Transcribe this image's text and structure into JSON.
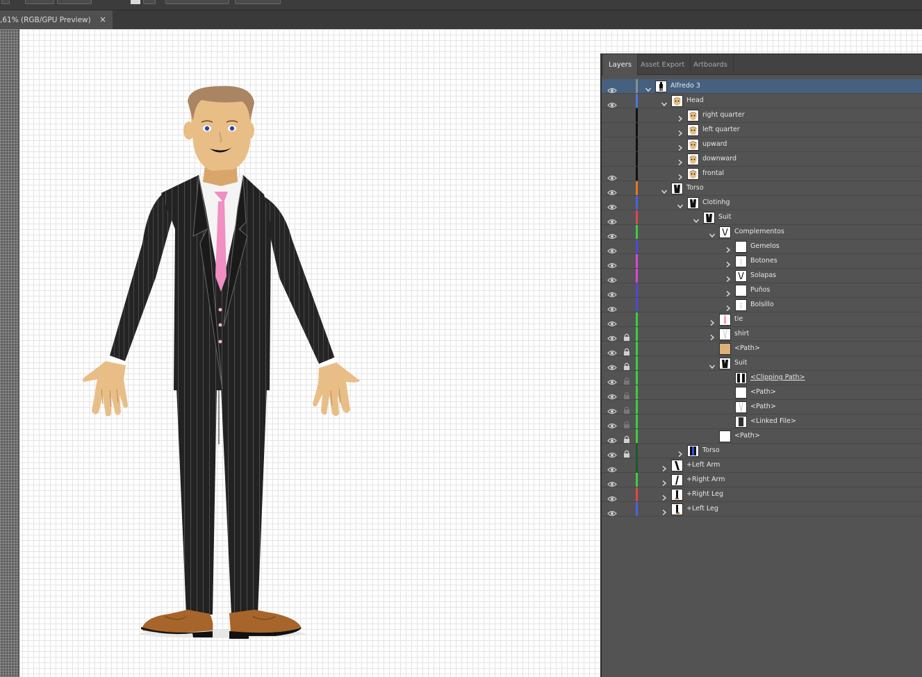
{
  "document_tab": {
    "title": ",61% (RGB/GPU Preview)",
    "close_glyph": "×"
  },
  "colors": {
    "canvas_background": "#ffffff",
    "grid_line": "#e4e4e4",
    "panel_background": "#535353",
    "selected_row": "#46607f"
  },
  "layers_panel": {
    "tabs": [
      {
        "label": "Layers",
        "active": true
      },
      {
        "label": "Asset Export",
        "active": false
      },
      {
        "label": "Artboards",
        "active": false
      }
    ],
    "layers": [
      {
        "name": "Alfredo 3",
        "depth": 0,
        "expanded": true,
        "visible": true,
        "locked": false,
        "color": "#8d8d8d",
        "selected": true,
        "thumb": "figure"
      },
      {
        "name": "Head",
        "depth": 1,
        "expanded": true,
        "visible": true,
        "locked": false,
        "color": "#4a78e0",
        "thumb": "face"
      },
      {
        "name": "right quarter",
        "depth": 2,
        "expanded": false,
        "visible": false,
        "locked": false,
        "color": "#111111",
        "thumb": "face"
      },
      {
        "name": "left quarter",
        "depth": 2,
        "expanded": false,
        "visible": false,
        "locked": false,
        "color": "#111111",
        "thumb": "face"
      },
      {
        "name": "upward",
        "depth": 2,
        "expanded": false,
        "visible": false,
        "locked": false,
        "color": "#111111",
        "thumb": "face"
      },
      {
        "name": "downward",
        "depth": 2,
        "expanded": false,
        "visible": false,
        "locked": false,
        "color": "#111111",
        "thumb": "face"
      },
      {
        "name": "frontal",
        "depth": 2,
        "expanded": false,
        "visible": true,
        "locked": false,
        "color": "#111111",
        "thumb": "face"
      },
      {
        "name": "Torso",
        "depth": 1,
        "expanded": true,
        "visible": true,
        "locked": false,
        "color": "#e07a28",
        "thumb": "torso"
      },
      {
        "name": "Clotinhg",
        "depth": 2,
        "expanded": true,
        "visible": true,
        "locked": false,
        "color": "#4a62e0",
        "thumb": "torso"
      },
      {
        "name": "Suit",
        "depth": 3,
        "expanded": true,
        "visible": true,
        "locked": false,
        "color": "#e04848",
        "thumb": "torso"
      },
      {
        "name": "Complementos",
        "depth": 4,
        "expanded": true,
        "visible": true,
        "locked": false,
        "color": "#3ccf3c",
        "thumb": "vlines"
      },
      {
        "name": "Gemelos",
        "depth": 5,
        "expanded": false,
        "visible": true,
        "locked": false,
        "color": "#5048d8",
        "thumb": "blank"
      },
      {
        "name": "Botones",
        "depth": 5,
        "expanded": false,
        "visible": true,
        "locked": false,
        "color": "#d848d8",
        "thumb": "dots"
      },
      {
        "name": "Solapas",
        "depth": 5,
        "expanded": false,
        "visible": true,
        "locked": false,
        "color": "#d848d8",
        "thumb": "vlines"
      },
      {
        "name": "Puños",
        "depth": 5,
        "expanded": false,
        "visible": true,
        "locked": false,
        "color": "#5048d8",
        "thumb": "blank"
      },
      {
        "name": "Bolsillo",
        "depth": 5,
        "expanded": false,
        "visible": true,
        "locked": false,
        "color": "#5048d8",
        "thumb": "dots"
      },
      {
        "name": "tie",
        "depth": 4,
        "expanded": false,
        "visible": true,
        "locked": false,
        "color": "#3ccf3c",
        "thumb": "tie"
      },
      {
        "name": "shirt",
        "depth": 4,
        "expanded": false,
        "visible": true,
        "locked": true,
        "color": "#3ccf3c",
        "thumb": "shirt"
      },
      {
        "name": "<Path>",
        "depth": 4,
        "chevron": false,
        "visible": true,
        "locked": true,
        "color": "#3ccf3c",
        "thumb": "skin"
      },
      {
        "name": "Suit",
        "depth": 4,
        "expanded": true,
        "visible": true,
        "locked": true,
        "color": "#3ccf3c",
        "thumb": "torso"
      },
      {
        "name": "<Clipping Path>",
        "depth": 5,
        "chevron": false,
        "visible": true,
        "locked": true,
        "color": "#3ccf3c",
        "thumb": "clip",
        "clip": true
      },
      {
        "name": "<Path>",
        "depth": 5,
        "chevron": false,
        "visible": true,
        "locked": true,
        "color": "#3ccf3c",
        "thumb": "blank"
      },
      {
        "name": "<Path>",
        "depth": 5,
        "chevron": false,
        "visible": true,
        "locked": true,
        "color": "#3ccf3c",
        "thumb": "shirt"
      },
      {
        "name": "<Linked File>",
        "depth": 5,
        "chevron": false,
        "visible": true,
        "locked": true,
        "color": "#3ccf3c",
        "thumb": "linked"
      },
      {
        "name": "<Path>",
        "depth": 4,
        "chevron": false,
        "visible": true,
        "locked": true,
        "color": "#3ccf3c",
        "thumb": "blank"
      },
      {
        "name": "Torso",
        "depth": 2,
        "expanded": false,
        "visible": true,
        "locked": true,
        "color": "#1a5a2a",
        "thumb": "bluetorso"
      },
      {
        "name": "+Left Arm",
        "depth": 1,
        "expanded": false,
        "visible": true,
        "locked": false,
        "color": "#1a5a2a",
        "thumb": "arm"
      },
      {
        "name": "+Right Arm",
        "depth": 1,
        "expanded": false,
        "visible": true,
        "locked": false,
        "color": "#3ccf3c",
        "thumb": "arm2"
      },
      {
        "name": "+Right Leg",
        "depth": 1,
        "expanded": false,
        "visible": true,
        "locked": false,
        "color": "#e04848",
        "thumb": "leg"
      },
      {
        "name": "+Left Leg",
        "depth": 1,
        "expanded": false,
        "visible": true,
        "locked": false,
        "color": "#4a62e0",
        "thumb": "leg2"
      }
    ]
  }
}
